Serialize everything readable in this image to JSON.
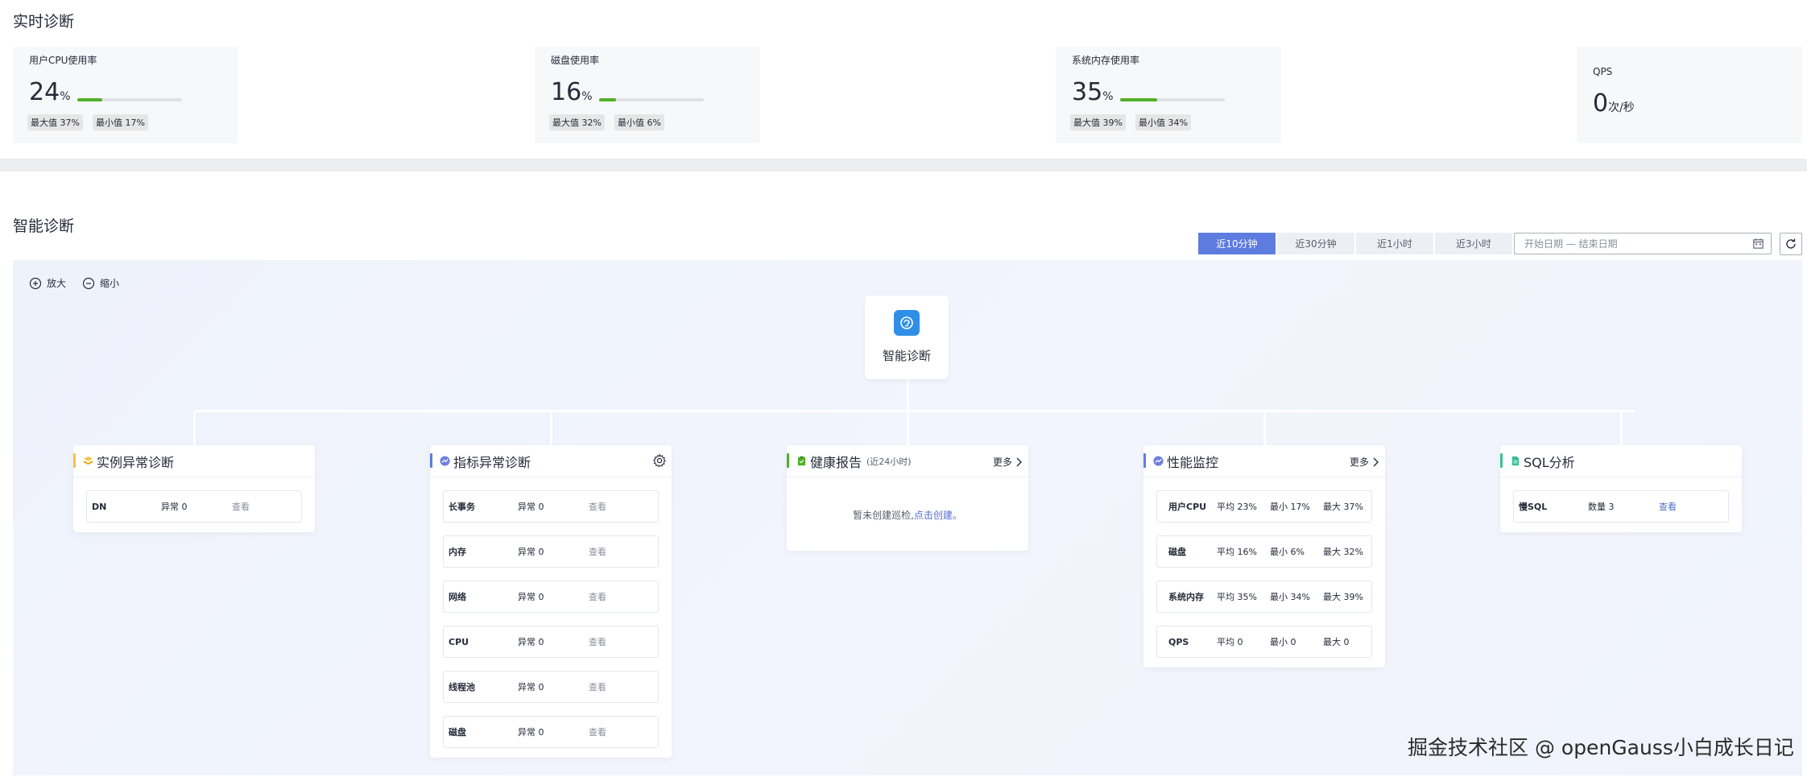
{
  "realtime": {
    "title": "实时诊断",
    "cards": [
      {
        "label": "用户CPU使用率",
        "value": "24",
        "unit": "%",
        "progress": 0.24,
        "max": "最大值 37%",
        "min": "最小值 17%"
      },
      {
        "label": "磁盘使用率",
        "value": "16",
        "unit": "%",
        "progress": 0.16,
        "max": "最大值 32%",
        "min": "最小值 6%"
      },
      {
        "label": "系统内存使用率",
        "value": "35",
        "unit": "%",
        "progress": 0.35,
        "max": "最大值 39%",
        "min": "最小值 34%"
      }
    ],
    "qps": {
      "label": "QPS",
      "value": "0",
      "unit": "次/秒"
    }
  },
  "smart": {
    "title": "智能诊断",
    "time_tabs": [
      "近10分钟",
      "近30分钟",
      "近1小时",
      "近3小时"
    ],
    "active_tab": 0,
    "date_placeholder": "开始日期 — 结束日期",
    "zoom_in": "放大",
    "zoom_out": "缩小",
    "root": "智能诊断",
    "instance": {
      "title": "实例异常诊断",
      "rows": [
        {
          "name": "DN",
          "status": "异常 0",
          "action": "查看"
        }
      ]
    },
    "metric": {
      "title": "指标异常诊断",
      "rows": [
        {
          "name": "长事务",
          "status": "异常 0",
          "action": "查看"
        },
        {
          "name": "内存",
          "status": "异常 0",
          "action": "查看"
        },
        {
          "name": "网络",
          "status": "异常 0",
          "action": "查看"
        },
        {
          "name": "CPU",
          "status": "异常 0",
          "action": "查看"
        },
        {
          "name": "线程池",
          "status": "异常 0",
          "action": "查看"
        },
        {
          "name": "磁盘",
          "status": "异常 0",
          "action": "查看"
        }
      ]
    },
    "health": {
      "title": "健康报告",
      "subtitle": "(近24小时)",
      "more": "更多",
      "empty_text": "暂未创建巡检,",
      "empty_link": "点击创建。"
    },
    "perf": {
      "title": "性能监控",
      "more": "更多",
      "rows": [
        {
          "name": "用户CPU",
          "avg": "平均 23%",
          "min": "最小 17%",
          "max": "最大 37%"
        },
        {
          "name": "磁盘",
          "avg": "平均 16%",
          "min": "最小 6%",
          "max": "最大 32%"
        },
        {
          "name": "系统内存",
          "avg": "平均 35%",
          "min": "最小 34%",
          "max": "最大 39%"
        },
        {
          "name": "QPS",
          "avg": "平均 0",
          "min": "最小 0",
          "max": "最大 0"
        }
      ]
    },
    "sql": {
      "title": "SQL分析",
      "rows": [
        {
          "name": "慢SQL",
          "status": "数量 3",
          "action": "查看"
        }
      ]
    }
  },
  "watermark": "掘金技术社区 @ openGauss小白成长日记",
  "colors": {
    "accent": "#5e7ce0",
    "progress": "#50b02a",
    "link": "#526ecc"
  }
}
